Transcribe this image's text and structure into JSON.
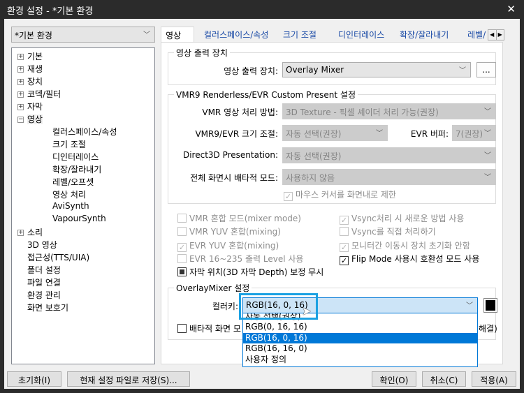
{
  "window": {
    "title": "환경 설정 - *기본 환경",
    "close": "✕"
  },
  "profile": {
    "value": "*기본 환경"
  },
  "tree": {
    "items": [
      {
        "label": "기본",
        "expander": "+"
      },
      {
        "label": "재생",
        "expander": "+"
      },
      {
        "label": "장치",
        "expander": "+"
      },
      {
        "label": "코덱/필터",
        "expander": "+"
      },
      {
        "label": "자막",
        "expander": "+"
      },
      {
        "label": "영상",
        "expander": "−",
        "selected": true
      },
      {
        "label": "컬러스페이스/속성",
        "child": true
      },
      {
        "label": "크기 조절",
        "child": true
      },
      {
        "label": "디인터레이스",
        "child": true
      },
      {
        "label": "확장/잘라내기",
        "child": true
      },
      {
        "label": "레벨/오프셋",
        "child": true
      },
      {
        "label": "영상 처리",
        "child": true
      },
      {
        "label": "AviSynth",
        "child": true
      },
      {
        "label": "VapourSynth",
        "child": true
      },
      {
        "label": "소리",
        "expander": "+"
      },
      {
        "label": "3D 영상"
      },
      {
        "label": "접근성(TTS/UIA)"
      },
      {
        "label": "폴더 설정"
      },
      {
        "label": "파일 연결"
      },
      {
        "label": "환경 관리"
      },
      {
        "label": "화면 보호기"
      }
    ]
  },
  "tabs": [
    "영상",
    "컬러스페이스/속성",
    "크기 조절",
    "디인터레이스",
    "확장/잘라내기",
    "레벨/"
  ],
  "output": {
    "group": "영상 출력 장치",
    "label": "영상 출력 장치:",
    "value": "Overlay Mixer",
    "more": "..."
  },
  "vmr": {
    "group": "VMR9 Renderless/EVR Custom Present 설정",
    "method_label": "VMR 영상 처리 방법:",
    "method": "3D Texture - 픽셀 셰이더 처리 가능(권장)",
    "resize_label": "VMR9/EVR 크기 조절:",
    "resize": "자동 선택(권장)",
    "buffer_label": "EVR 버퍼:",
    "buffer": "7(권장)",
    "d3d_label": "Direct3D Presentation:",
    "d3d": "자동 선택(권장)",
    "excl_label": "전체 화면시 배타적 모드:",
    "excl": "사용하지 않음",
    "mouse": "마우스 커서를 화면내로 제한"
  },
  "checks": [
    {
      "label": "VMR 혼합 모드(mixer mode)",
      "checked": false,
      "enabled": false
    },
    {
      "label": "Vsync처리 시 새로운 방법 사용",
      "checked": true,
      "enabled": false
    },
    {
      "label": "VMR YUV 혼합(mixing)",
      "checked": false,
      "enabled": false
    },
    {
      "label": "Vsync를 직접 처리하기",
      "checked": false,
      "enabled": false
    },
    {
      "label": "EVR YUV 혼합(mixing)",
      "checked": true,
      "enabled": false
    },
    {
      "label": "모니터간 이동시 장치 초기화 안함",
      "checked": true,
      "enabled": false
    },
    {
      "label": "EVR 16~235 출력 Level 사용",
      "checked": false,
      "enabled": false
    },
    {
      "label": "Flip Mode 사용시 호환성 모드 사용",
      "checked": true,
      "enabled": true
    },
    {
      "label": "자막 위치(3D 자막 Depth) 보정 무시",
      "checked": "indeterminate",
      "enabled": true
    }
  ],
  "overlay": {
    "group": "OverlayMixer 설정",
    "colorkey_label": "컬러키:",
    "colorkey": "RGB(16, 0, 16)",
    "swatch_color": "#000000",
    "exclusive_label": "배타적 화면 모",
    "exclusive_tail": "해결)",
    "options": [
      "자동 선택(권장)",
      "RGB(0, 16, 16)",
      "RGB(16, 0, 16)",
      "RGB(16, 16, 0)",
      "사용자 정의"
    ],
    "selected_index": 2
  },
  "buttons": {
    "reset": "초기화(I)",
    "save": "현재 설정 파일로 저장(S)...",
    "ok": "확인(O)",
    "cancel": "취소(C)",
    "apply": "적용(A)"
  },
  "colors": {
    "accent": "#0078d7",
    "highlight": "#1ba1e2"
  }
}
